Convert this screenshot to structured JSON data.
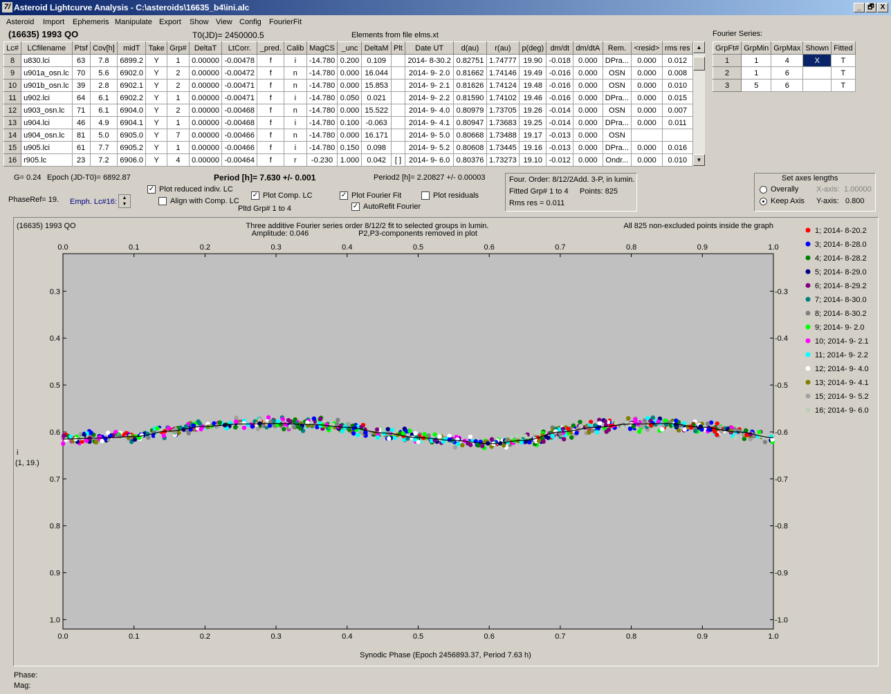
{
  "window": {
    "title": "Asteroid Lightcurve Analysis - C:\\asteroids\\16635_b4\\ini.alc",
    "buttons": [
      "_",
      "🗗",
      "X"
    ]
  },
  "menu": [
    "Asteroid",
    "Import",
    "Ephemeris",
    "Manipulate",
    "Export",
    "Show",
    "View",
    "Config",
    "FourierFit"
  ],
  "header": {
    "asteroid": "(16635) 1993 QO",
    "t0": "T0(JD)= 2450000.5",
    "elements": "Elements from file elms.xt",
    "fourier_label": "Fourier Series:"
  },
  "lc_table": {
    "columns": [
      "Lc#",
      "LCfilename",
      "Ptsf",
      "Cov[h]",
      "midT",
      "Take",
      "Grp#",
      "DeltaT",
      "LtCorr.",
      "_pred.",
      "Calib",
      "MagCS",
      "_unc",
      "DeltaM",
      "Plt",
      "Date UT",
      "d(au)",
      "r(au)",
      "p(deg)",
      "dm/dt",
      "dm/dtA",
      "Rem.",
      "<resid>",
      "rms res"
    ],
    "rows": [
      [
        "8",
        "u830.lci",
        "63",
        "7.8",
        "6899.2",
        "Y",
        "1",
        "0.00000",
        "-0.00478",
        "f",
        "i",
        "-14.780",
        "0.200",
        "0.109",
        "",
        "2014- 8-30.2",
        "0.82751",
        "1.74777",
        "19.90",
        "-0.018",
        "0.000",
        "DPra...",
        "0.000",
        "0.012"
      ],
      [
        "9",
        "u901a_osn.lc",
        "70",
        "5.6",
        "6902.0",
        "Y",
        "2",
        "0.00000",
        "-0.00472",
        "f",
        "n",
        "-14.780",
        "0.000",
        "16.044",
        "",
        "2014- 9- 2.0",
        "0.81662",
        "1.74146",
        "19.49",
        "-0.016",
        "0.000",
        "OSN",
        "0.000",
        "0.008"
      ],
      [
        "10",
        "u901b_osn.lc",
        "39",
        "2.8",
        "6902.1",
        "Y",
        "2",
        "0.00000",
        "-0.00471",
        "f",
        "n",
        "-14.780",
        "0.000",
        "15.853",
        "",
        "2014- 9- 2.1",
        "0.81626",
        "1.74124",
        "19.48",
        "-0.016",
        "0.000",
        "OSN",
        "0.000",
        "0.010"
      ],
      [
        "11",
        "u902.lci",
        "64",
        "6.1",
        "6902.2",
        "Y",
        "1",
        "0.00000",
        "-0.00471",
        "f",
        "i",
        "-14.780",
        "0.050",
        "0.021",
        "",
        "2014- 9- 2.2",
        "0.81590",
        "1.74102",
        "19.46",
        "-0.016",
        "0.000",
        "DPra...",
        "0.000",
        "0.015"
      ],
      [
        "12",
        "u903_osn.lc",
        "71",
        "6.1",
        "6904.0",
        "Y",
        "2",
        "0.00000",
        "-0.00468",
        "f",
        "n",
        "-14.780",
        "0.000",
        "15.522",
        "",
        "2014- 9- 4.0",
        "0.80979",
        "1.73705",
        "19.26",
        "-0.014",
        "0.000",
        "OSN",
        "0.000",
        "0.007"
      ],
      [
        "13",
        "u904.lci",
        "46",
        "4.9",
        "6904.1",
        "Y",
        "1",
        "0.00000",
        "-0.00468",
        "f",
        "i",
        "-14.780",
        "0.100",
        "-0.063",
        "",
        "2014- 9- 4.1",
        "0.80947",
        "1.73683",
        "19.25",
        "-0.014",
        "0.000",
        "DPra...",
        "0.000",
        "0.011"
      ],
      [
        "14",
        "u904_osn.lc",
        "81",
        "5.0",
        "6905.0",
        "Y",
        "7",
        "0.00000",
        "-0.00466",
        "f",
        "n",
        "-14.780",
        "0.000",
        "16.171",
        "",
        "2014- 9- 5.0",
        "0.80668",
        "1.73488",
        "19.17",
        "-0.013",
        "0.000",
        "OSN",
        "",
        ""
      ],
      [
        "15",
        "u905.lci",
        "61",
        "7.7",
        "6905.2",
        "Y",
        "1",
        "0.00000",
        "-0.00466",
        "f",
        "i",
        "-14.780",
        "0.150",
        "0.098",
        "",
        "2014- 9- 5.2",
        "0.80608",
        "1.73445",
        "19.16",
        "-0.013",
        "0.000",
        "DPra...",
        "0.000",
        "0.016"
      ],
      [
        "16",
        "r905.lc",
        "23",
        "7.2",
        "6906.0",
        "Y",
        "4",
        "0.00000",
        "-0.00464",
        "f",
        "r",
        "-0.230",
        "1.000",
        "0.042",
        "[ ]",
        "2014- 9- 6.0",
        "0.80376",
        "1.73273",
        "19.10",
        "-0.012",
        "0.000",
        "Ondr...",
        "0.000",
        "0.010"
      ]
    ]
  },
  "fourier_table": {
    "columns": [
      "GrpFt#",
      "GrpMin",
      "GrpMax",
      "Shown",
      "Fitted"
    ],
    "rows": [
      [
        "1",
        "1",
        "4",
        "X",
        "T"
      ],
      [
        "2",
        "1",
        "6",
        "",
        "T"
      ],
      [
        "3",
        "5",
        "6",
        "",
        "T"
      ]
    ]
  },
  "controls": {
    "g": "G= 0.24",
    "epoch": "Epoch (JD-T0)= 6892.87",
    "period": "Period [h]= 7.630 +/- 0.001",
    "period2": "Period2 [h]= 2.20827 +/- 0.00003",
    "phaseref": "PhaseRef= 19.",
    "emph": "Emph. Lc#16:",
    "plot_reduced": "Plot reduced indiv. LC",
    "align": "Align with Comp. LC",
    "plot_comp": "Plot Comp. LC",
    "pltd_grp": "Pltd Grp#  1   to   4",
    "plot_fourier": "Plot Fourier Fit",
    "autorefit": "AutoRefit Fourier",
    "plot_resid": "Plot residuals",
    "four_order": "Four. Order:  8/12/2Add. 3-P, in lumin.",
    "fitted_grp": "Fitted Grp# 1 to 4",
    "points": "Points: 825",
    "rms": "Rms res      = 0.011",
    "axes_title": "Set axes lengths",
    "overally": "Overally",
    "keep_axis": "Keep Axis",
    "xaxis_label": "X-axis:",
    "xaxis_val": "1.00000",
    "yaxis_label": "Y-axis:",
    "yaxis_val": "0.800"
  },
  "plot": {
    "top_left": "(16635) 1993 QO",
    "line1": "Three additive Fourier series order 8/12/2 fit to selected groups in lumin.",
    "amplitude": "Amplitude: 0.046",
    "components": "P2,P3-components removed in plot",
    "top_right": "All 825 non-excluded points inside the graph",
    "xlabel": "Synodic Phase (Epoch 2456893.37, Period 7.63 h)",
    "ylabel_1": "i",
    "ylabel_2": "(1, 19.)"
  },
  "chart_data": {
    "type": "scatter",
    "x_ticks": [
      "0.0",
      "0.1",
      "0.2",
      "0.3",
      "0.4",
      "0.5",
      "0.6",
      "0.7",
      "0.8",
      "0.9",
      "1.0"
    ],
    "y_ticks": [
      "0.3",
      "0.4",
      "0.5",
      "0.6",
      "0.7",
      "0.8",
      "0.9",
      "1.0"
    ],
    "xlim": [
      0,
      1
    ],
    "ylim": [
      0.22,
      1.02
    ],
    "y_inverted": true,
    "fit_curve": {
      "x": [
        0,
        0.05,
        0.1,
        0.15,
        0.2,
        0.25,
        0.3,
        0.35,
        0.4,
        0.45,
        0.5,
        0.55,
        0.6,
        0.65,
        0.7,
        0.75,
        0.8,
        0.85,
        0.9,
        0.95,
        1.0
      ],
      "y": [
        0.615,
        0.613,
        0.61,
        0.598,
        0.588,
        0.583,
        0.582,
        0.584,
        0.59,
        0.602,
        0.612,
        0.618,
        0.625,
        0.618,
        0.6,
        0.59,
        0.583,
        0.582,
        0.59,
        0.6,
        0.612
      ]
    },
    "series": [
      {
        "name": "1; 2014- 8-20.2",
        "color": "#ff0000"
      },
      {
        "name": "3; 2014- 8-28.0",
        "color": "#0000ff"
      },
      {
        "name": "4; 2014- 8-28.2",
        "color": "#008000"
      },
      {
        "name": "5; 2014- 8-29.0",
        "color": "#000080"
      },
      {
        "name": "6; 2014- 8-29.2",
        "color": "#800080"
      },
      {
        "name": "7; 2014- 8-30.0",
        "color": "#008080"
      },
      {
        "name": "8; 2014- 8-30.2",
        "color": "#808080"
      },
      {
        "name": "9; 2014- 9- 2.0",
        "color": "#00ff00"
      },
      {
        "name": "10; 2014- 9- 2.1",
        "color": "#ff00ff"
      },
      {
        "name": "11; 2014- 9- 2.2",
        "color": "#00ffff"
      },
      {
        "name": "12; 2014- 9- 4.0",
        "color": "#ffffff"
      },
      {
        "name": "13; 2014- 9- 4.1",
        "color": "#808000"
      },
      {
        "name": "15; 2014- 9- 5.2",
        "color": "#a0a0a0"
      },
      {
        "name": "16; 2014- 9- 6.0",
        "color": "#b8d0b8"
      }
    ]
  },
  "status": {
    "phase": "Phase:",
    "mag": "Mag:"
  }
}
